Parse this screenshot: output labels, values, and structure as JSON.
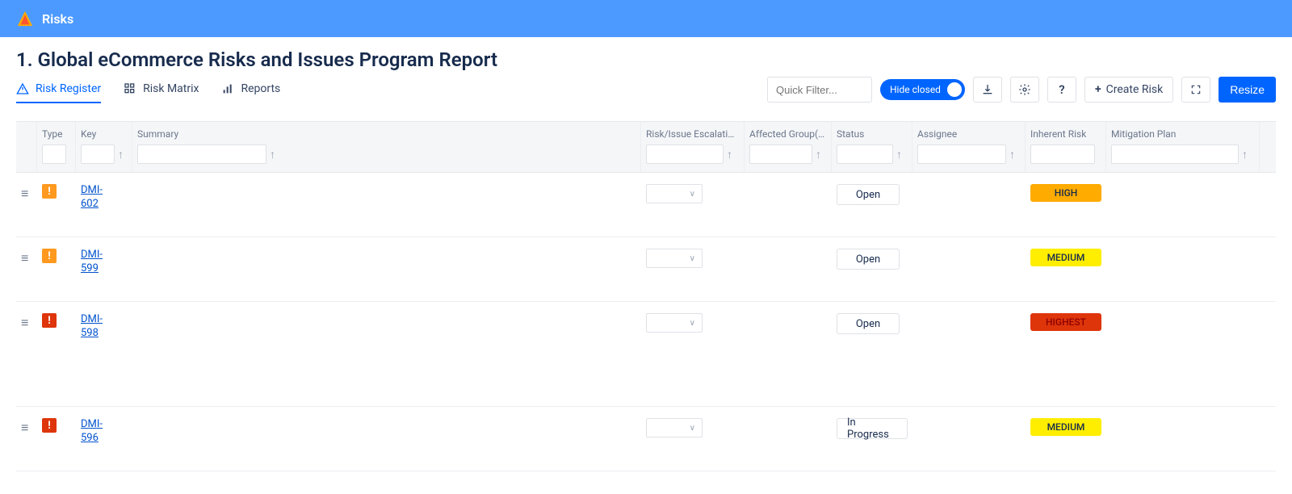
{
  "app": {
    "name": "Risks"
  },
  "page": {
    "title": "1. Global eCommerce Risks and Issues Program Report"
  },
  "tabs": [
    {
      "id": "register",
      "label": "Risk Register",
      "active": true
    },
    {
      "id": "matrix",
      "label": "Risk Matrix",
      "active": false
    },
    {
      "id": "reports",
      "label": "Reports",
      "active": false
    }
  ],
  "toolbar": {
    "quick_filter_placeholder": "Quick Filter...",
    "hide_closed_label": "Hide closed",
    "create_label": "Create Risk",
    "resize_label": "Resize"
  },
  "columns": {
    "type": "Type",
    "key": "Key",
    "summary": "Summary",
    "escalation": "Risk/Issue Escalation Lev",
    "groups": "Affected Group(s)",
    "status": "Status",
    "assignee": "Assignee",
    "inherent": "Inherent Risk",
    "mitigation": "Mitigation Plan"
  },
  "rows": [
    {
      "type": "orange",
      "key": "DMI-602",
      "status": "Open",
      "inherent": "HIGH"
    },
    {
      "type": "orange",
      "key": "DMI-599",
      "status": "Open",
      "inherent": "MEDIUM"
    },
    {
      "type": "red",
      "key": "DMI-598",
      "status": "Open",
      "inherent": "HIGHEST",
      "tall": true
    },
    {
      "type": "red",
      "key": "DMI-596",
      "status": "In Progress",
      "inherent": "MEDIUM"
    }
  ]
}
